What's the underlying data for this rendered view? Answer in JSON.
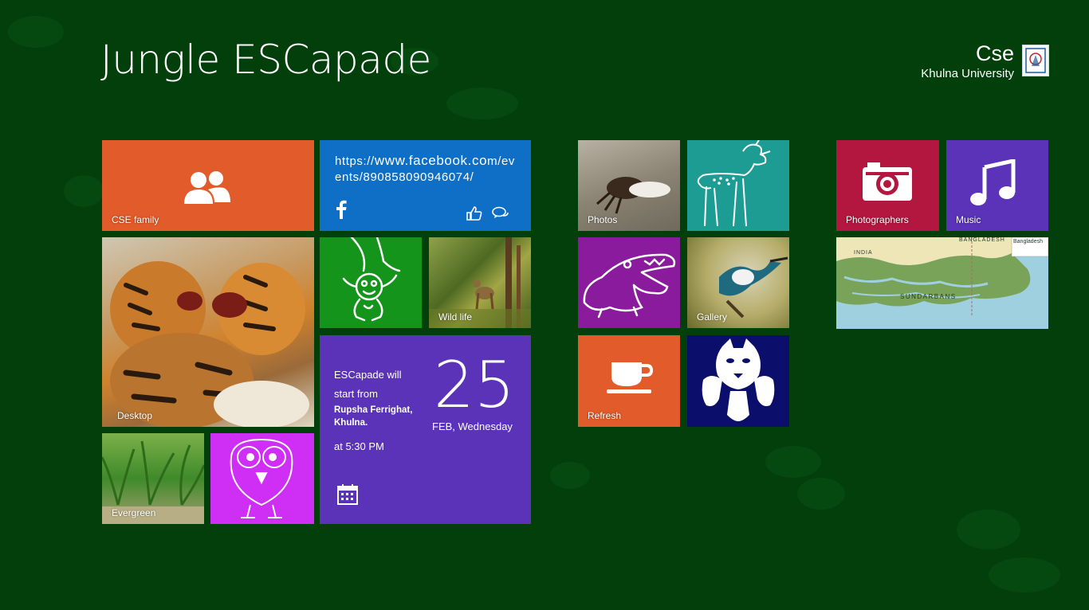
{
  "header": {
    "app_title": "Jungle ESCapade",
    "user_name": "Cse",
    "user_org": "Khulna University"
  },
  "tiles": {
    "cse_family": {
      "label": "CSE family",
      "color": "#e25b2a",
      "icon": "people-icon"
    },
    "facebook": {
      "url_prefix": "https://",
      "url_big": "www.facebook.co",
      "url_rest": "m/events/890858090946074/",
      "color": "#0f6fc6",
      "icons": [
        "facebook-icon",
        "like-icon",
        "comment-icon"
      ]
    },
    "desktop": {
      "label": "Desktop",
      "image": "tigers-photo"
    },
    "monkey": {
      "color": "#15941b",
      "icon": "monkey-icon"
    },
    "wildlife": {
      "label": "Wild life",
      "image": "deer-forest-photo"
    },
    "event": {
      "line1": "ESCapade will",
      "line2": "start from",
      "place": "Rupsha Ferrighat, Khulna.",
      "time": "at 5:30  PM",
      "day": "25",
      "date": "FEB, Wednesday",
      "color": "#5a33b8",
      "icon": "calendar-icon"
    },
    "evergreen": {
      "label": "Evergreen",
      "image": "palm-forest-photo"
    },
    "owl": {
      "color": "#cf2ef5",
      "icon": "owl-icon"
    },
    "photos": {
      "label": "Photos",
      "image": "crab-photo"
    },
    "deer": {
      "color": "#1d9c93",
      "icon": "deer-icon"
    },
    "crocodile": {
      "color": "#8a1b9c",
      "icon": "crocodile-icon"
    },
    "gallery": {
      "label": "Gallery",
      "image": "kingfisher-photo"
    },
    "refresh": {
      "label": "Refresh",
      "color": "#e25b2a",
      "icon": "coffee-cup-icon"
    },
    "panther": {
      "color": "#0b0e6b",
      "icon": "panther-icon"
    },
    "photographers": {
      "label": "Photographers",
      "color": "#b3173f",
      "icon": "camera-icon"
    },
    "music": {
      "label": "Music",
      "color": "#5a33b8",
      "icon": "music-note-icon"
    },
    "map": {
      "image": "sundarbans-map",
      "label_india": "INDIA",
      "label_bangladesh": "BANGLADESH",
      "label_sundarbans": "SUNDARBANS",
      "inset_label": "Bangladesh"
    }
  },
  "colors": {
    "background": "#023f0a"
  }
}
